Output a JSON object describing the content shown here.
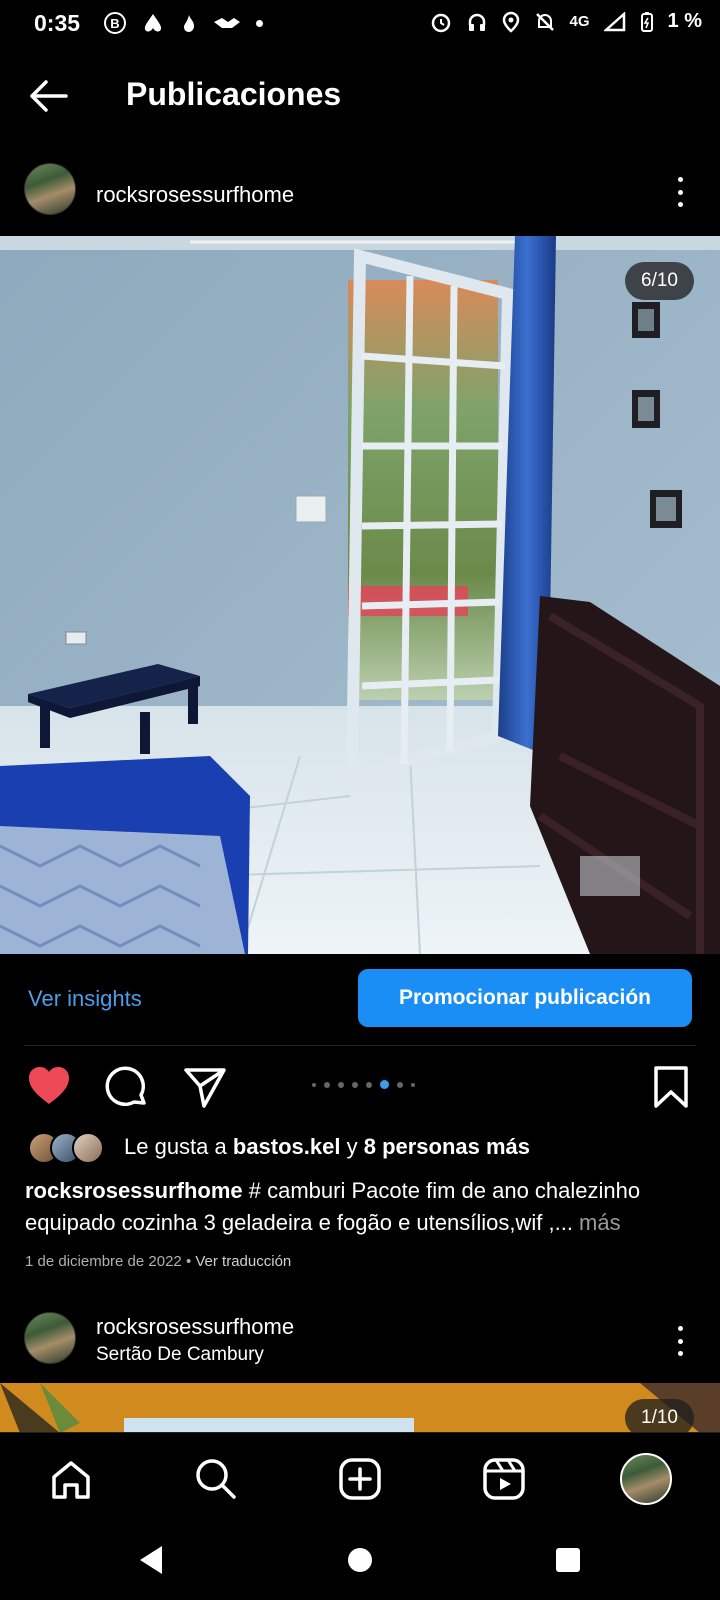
{
  "status_bar": {
    "time": "0:35",
    "network": "4G",
    "battery": "1 %"
  },
  "header": {
    "title": "Publicaciones"
  },
  "post1": {
    "username": "rocksrosessurfhome",
    "counter": "6/10",
    "insights_label": "Ver insights",
    "promote_label": "Promocionar publicación",
    "likes_prefix": "Le gusta a ",
    "likes_user": "bastos.kel",
    "likes_mid": " y ",
    "likes_others": "8 personas más",
    "caption_user": "rocksrosessurfhome",
    "caption_text": " # camburi Pacote fim de ano chalezinho equipado cozinha 3 geladeira e fogão e utensílios,wif ,...",
    "caption_more": " más",
    "date": "1 de diciembre de 2022",
    "separator": " • ",
    "translate_label": "Ver traducción",
    "liked": true,
    "carousel_active_index": 5
  },
  "post2": {
    "username": "rocksrosessurfhome",
    "location": "Sertão De Cambury",
    "counter": "1/10"
  },
  "colors": {
    "accent": "#1a8ef5",
    "link": "#4a9eea",
    "like": "#ed4956",
    "background": "#000000"
  },
  "icons": {
    "nav": [
      "home-icon",
      "search-icon",
      "create-icon",
      "reels-icon",
      "profile-avatar"
    ],
    "system": [
      "back-triangle",
      "home-circle",
      "recents-square"
    ]
  }
}
